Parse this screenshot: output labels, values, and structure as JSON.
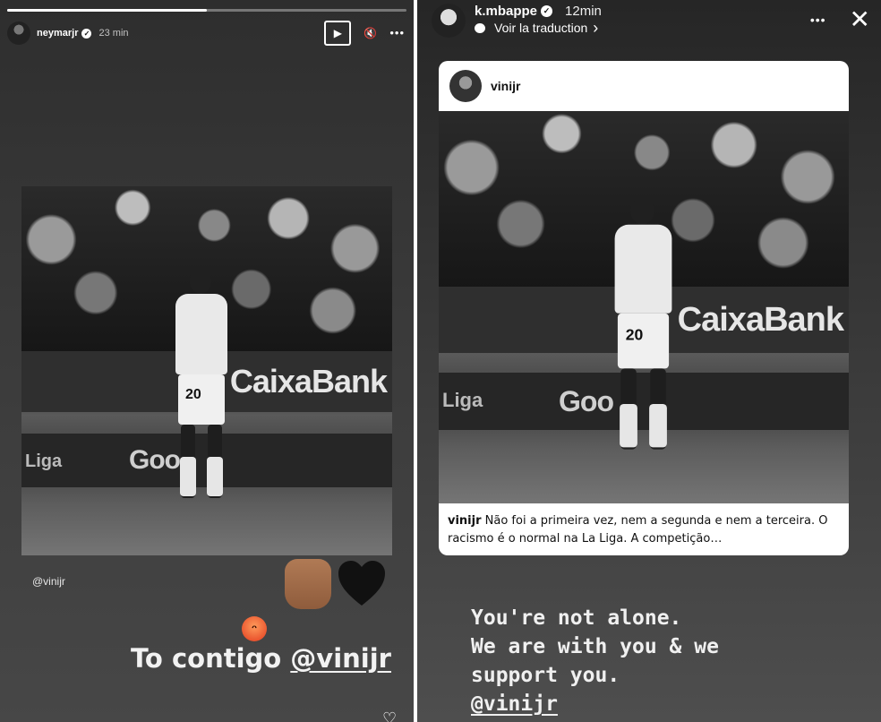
{
  "left_story": {
    "progress": 0.5,
    "username": "neymarjr",
    "verified_mark": "✓",
    "time": "23 min",
    "play_icon": "▶",
    "mute_icon": "🔇",
    "more_icon": "•••",
    "photo_banner": "CaixaBank",
    "photo_banner_lower": "Goo",
    "photo_banner_liga": "Liga",
    "jersey_number": "20",
    "mention_tag": "@vinijr",
    "caption_prefix": "To contigo ",
    "caption_mention": "@vinijr",
    "heart_icon": "♡"
  },
  "right_story": {
    "username": "k.mbappe",
    "verified_mark": "✓",
    "time": "12min",
    "translate_label": "Voir la traduction",
    "translate_chevron": "›",
    "more_icon": "•••",
    "close_icon": "✕",
    "card": {
      "username": "vinijr",
      "banner": "CaixaBank",
      "banner_lower": "Goo",
      "banner_liga": "Liga",
      "jersey_number": "20",
      "caption_user": "vinijr",
      "caption_text": " Não foi a primeira vez, nem a segunda e nem a terceira. O racismo é o normal na La Liga.  A competição…"
    },
    "caption_line1": "You're not alone.",
    "caption_line2": "We are with you & we",
    "caption_line3": "support you.",
    "caption_mention": "@vinijr"
  }
}
